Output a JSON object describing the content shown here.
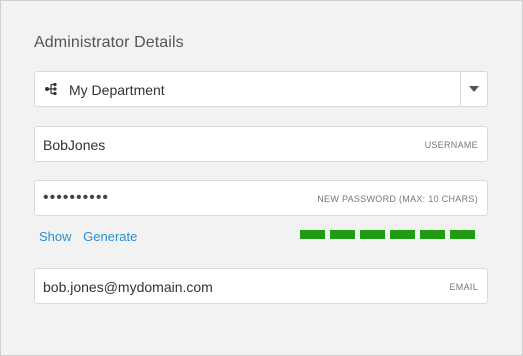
{
  "section": {
    "title": "Administrator Details"
  },
  "department": {
    "icon": "org-structure-icon",
    "selected": "My Department",
    "caret_icon": "caret-down-icon"
  },
  "username": {
    "value": "BobJones",
    "hint": "USERNAME"
  },
  "password": {
    "masked_value": "••••••••••",
    "hint": "NEW PASSWORD (MAX: 10 CHARS)",
    "show_label": "Show",
    "generate_label": "Generate",
    "strength": {
      "filled_segments": 6,
      "total_segments": 6,
      "color": "#1f9c12"
    }
  },
  "email": {
    "value": "bob.jones@mydomain.com",
    "hint": "EMAIL"
  },
  "colors": {
    "link": "#2b8fcf",
    "background": "#f2f2f2"
  }
}
